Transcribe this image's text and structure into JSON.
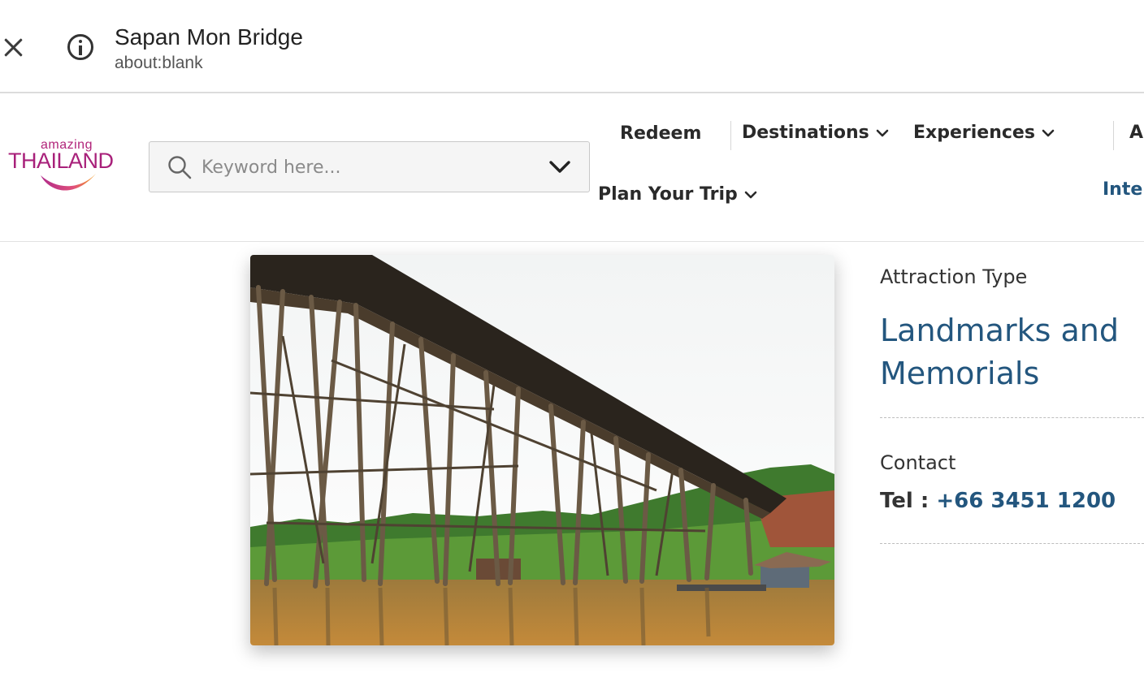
{
  "browser": {
    "title": "Sapan Mon Bridge",
    "url": "about:blank",
    "close_icon": "close-icon",
    "info_icon": "info-circle-icon"
  },
  "header": {
    "logo": {
      "small": "amazing",
      "big": "THAILAND"
    },
    "search": {
      "placeholder": "Keyword here...",
      "value": ""
    },
    "nav": {
      "redeem": "Redeem",
      "destinations": "Destinations",
      "experiences": "Experiences",
      "cut_item": "A",
      "plan_trip": "Plan Your Trip",
      "cut_link": "Inte"
    }
  },
  "main": {
    "image_alt": "Sapan Mon Bridge",
    "attraction_type_label": "Attraction Type",
    "attraction_type_value": "Landmarks and Memorials",
    "contact_label": "Contact",
    "tel_label": "Tel :",
    "tel_value": "+66 3451 1200"
  },
  "colors": {
    "brand": "#a8207a",
    "link": "#23567e",
    "logo_orange": "#f29a1f"
  }
}
